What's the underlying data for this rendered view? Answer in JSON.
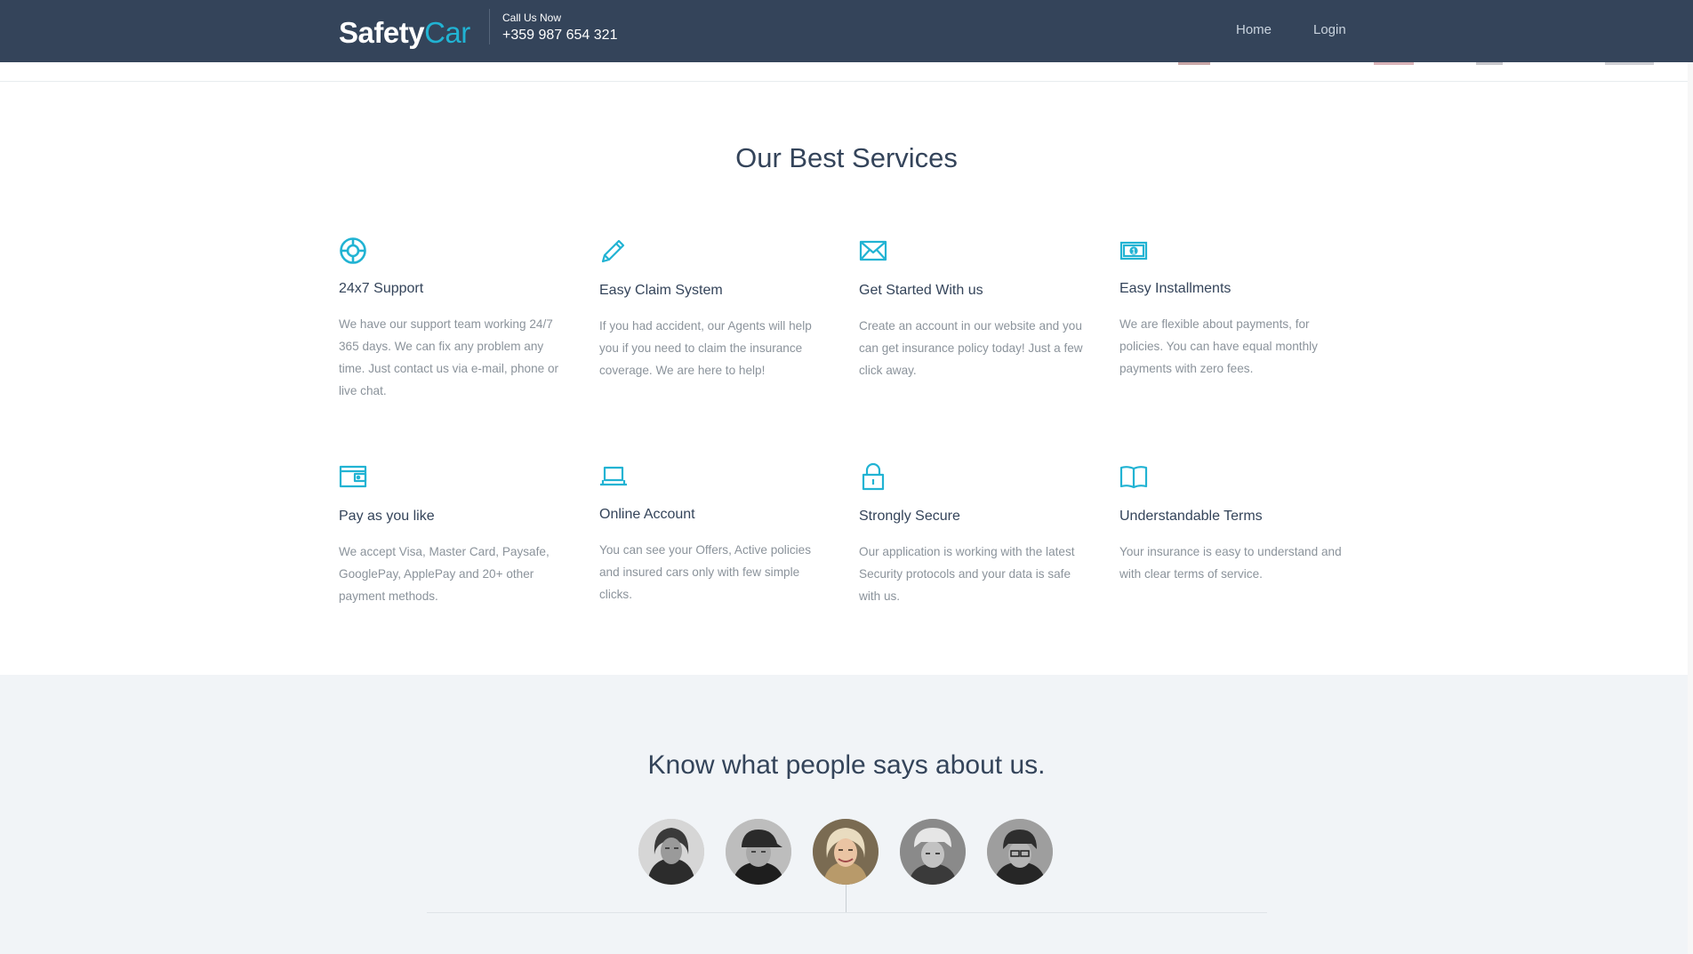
{
  "header": {
    "brand_part1": "Safety",
    "brand_part2": "Car",
    "call_label": "Call Us Now",
    "call_number": "+359 987 654 321",
    "nav": {
      "home": "Home",
      "login": "Login"
    }
  },
  "services": {
    "title": "Our Best Services",
    "items": [
      {
        "icon": "lifebuoy-icon",
        "title": "24x7 Support",
        "desc": "We have our support team working 24/7 365 days. We can fix any problem any time. Just contact us via e-mail, phone or live chat."
      },
      {
        "icon": "pencil-icon",
        "title": "Easy Claim System",
        "desc": "If you had accident, our Agents will help you if you need to claim the insurance coverage. We are here to help!"
      },
      {
        "icon": "envelope-icon",
        "title": "Get Started With us",
        "desc": "Create an account in our website and you can get insurance policy today! Just a few click away."
      },
      {
        "icon": "banknote-icon",
        "title": "Easy Installments",
        "desc": "We are flexible about payments, for policies. You can have equal monthly payments with zero fees."
      },
      {
        "icon": "wallet-icon",
        "title": "Pay as you like",
        "desc": "We accept Visa, Master Card, Paysafe, GooglePay, ApplePay and 20+ other payment methods."
      },
      {
        "icon": "laptop-icon",
        "title": "Online Account",
        "desc": "You can see your Offers, Active policies and insured cars only with few simple clicks."
      },
      {
        "icon": "lock-icon",
        "title": "Strongly Secure",
        "desc": "Our application is working with the latest Security protocols and your data is safe with us."
      },
      {
        "icon": "book-icon",
        "title": "Understandable Terms",
        "desc": "Your insurance is easy to understand and with clear terms of service."
      }
    ]
  },
  "testimonials": {
    "title": "Know what people says about us.",
    "avatars": [
      "avatar-1",
      "avatar-2",
      "avatar-3",
      "avatar-4",
      "avatar-5"
    ],
    "active_index": 2
  },
  "colors": {
    "navbar": "#34445a",
    "accent": "#21b3d3",
    "heading": "#34445a",
    "body_text": "#8b939b",
    "testimonial_bg": "#f1f4f7"
  }
}
